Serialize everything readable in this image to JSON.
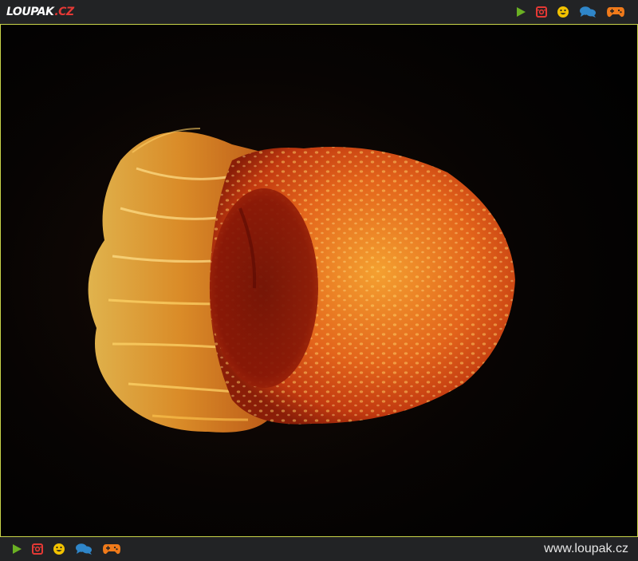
{
  "header": {
    "logo_main": "LOUPAK",
    "logo_suffix": ".CZ",
    "icons": [
      "play-icon",
      "instagram-icon",
      "smiley-icon",
      "chat-icon",
      "gamepad-icon"
    ]
  },
  "photo": {
    "subject": ""
  },
  "footer": {
    "icons": [
      "play-icon",
      "instagram-icon",
      "smiley-icon",
      "chat-icon",
      "gamepad-icon"
    ],
    "site_url": "www.loupak.cz"
  },
  "colors": {
    "bar_bg": "#222325",
    "frame_border": "#c9d44a",
    "play": "#6ab023",
    "instagram": "#e53935",
    "smiley": "#f2c200",
    "chat": "#2f86c9",
    "gamepad": "#f07a1a"
  }
}
